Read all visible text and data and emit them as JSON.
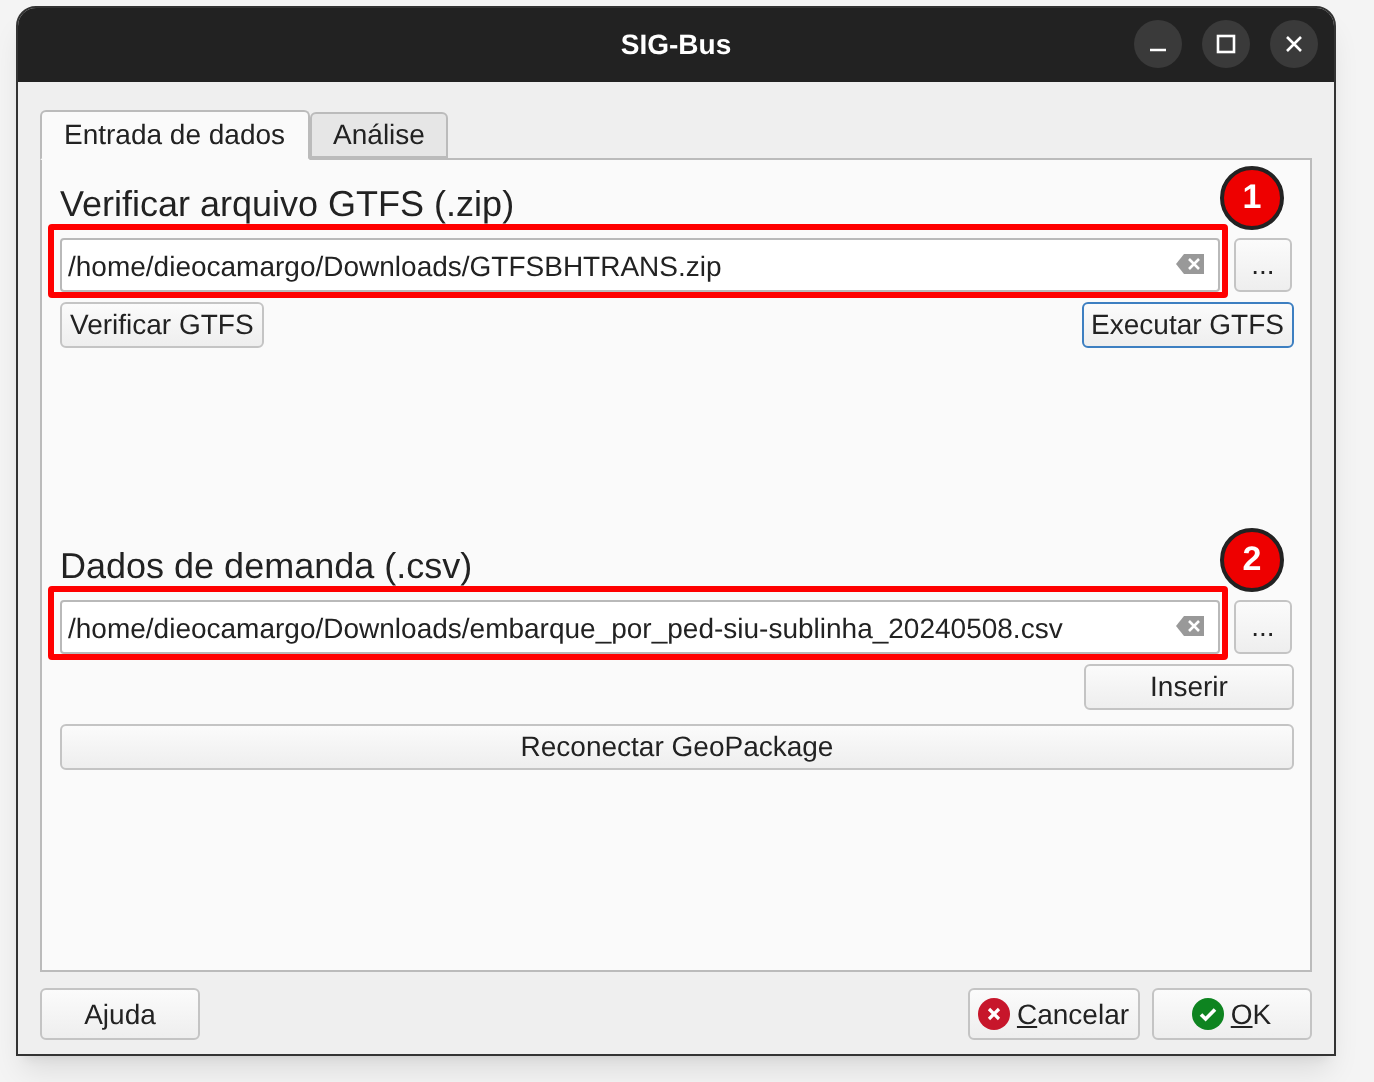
{
  "window": {
    "title": "SIG-Bus"
  },
  "tabs": [
    {
      "label": "Entrada de dados",
      "selected": true
    },
    {
      "label": "Análise",
      "selected": false
    }
  ],
  "sections": [
    {
      "heading": "Verificar arquivo GTFS (.zip)",
      "path": "/home/dieocamargo/Downloads/GTFSBHTRANS.zip",
      "browse_label": "...",
      "callout": "1",
      "buttons": [
        {
          "label": "Verificar GTFS",
          "kind": "left",
          "focused": false
        },
        {
          "label": "Executar GTFS",
          "kind": "right",
          "focused": true
        }
      ]
    },
    {
      "heading": "Dados de demanda (.csv)",
      "path": "/home/dieocamargo/Downloads/embarque_por_ped-siu-sublinha_20240508.csv",
      "browse_label": "...",
      "callout": "2",
      "buttons": [
        {
          "label": "Inserir",
          "kind": "right",
          "focused": false
        },
        {
          "label": "Reconectar GeoPackage",
          "kind": "full",
          "focused": false
        }
      ]
    }
  ],
  "footer": [
    {
      "label": "Ajuda",
      "kind": "plain",
      "mnemonic": false
    },
    {
      "label": "Cancelar",
      "kind": "cancel",
      "mnemonic": true
    },
    {
      "label": "OK",
      "kind": "confirm",
      "mnemonic": true
    }
  ]
}
